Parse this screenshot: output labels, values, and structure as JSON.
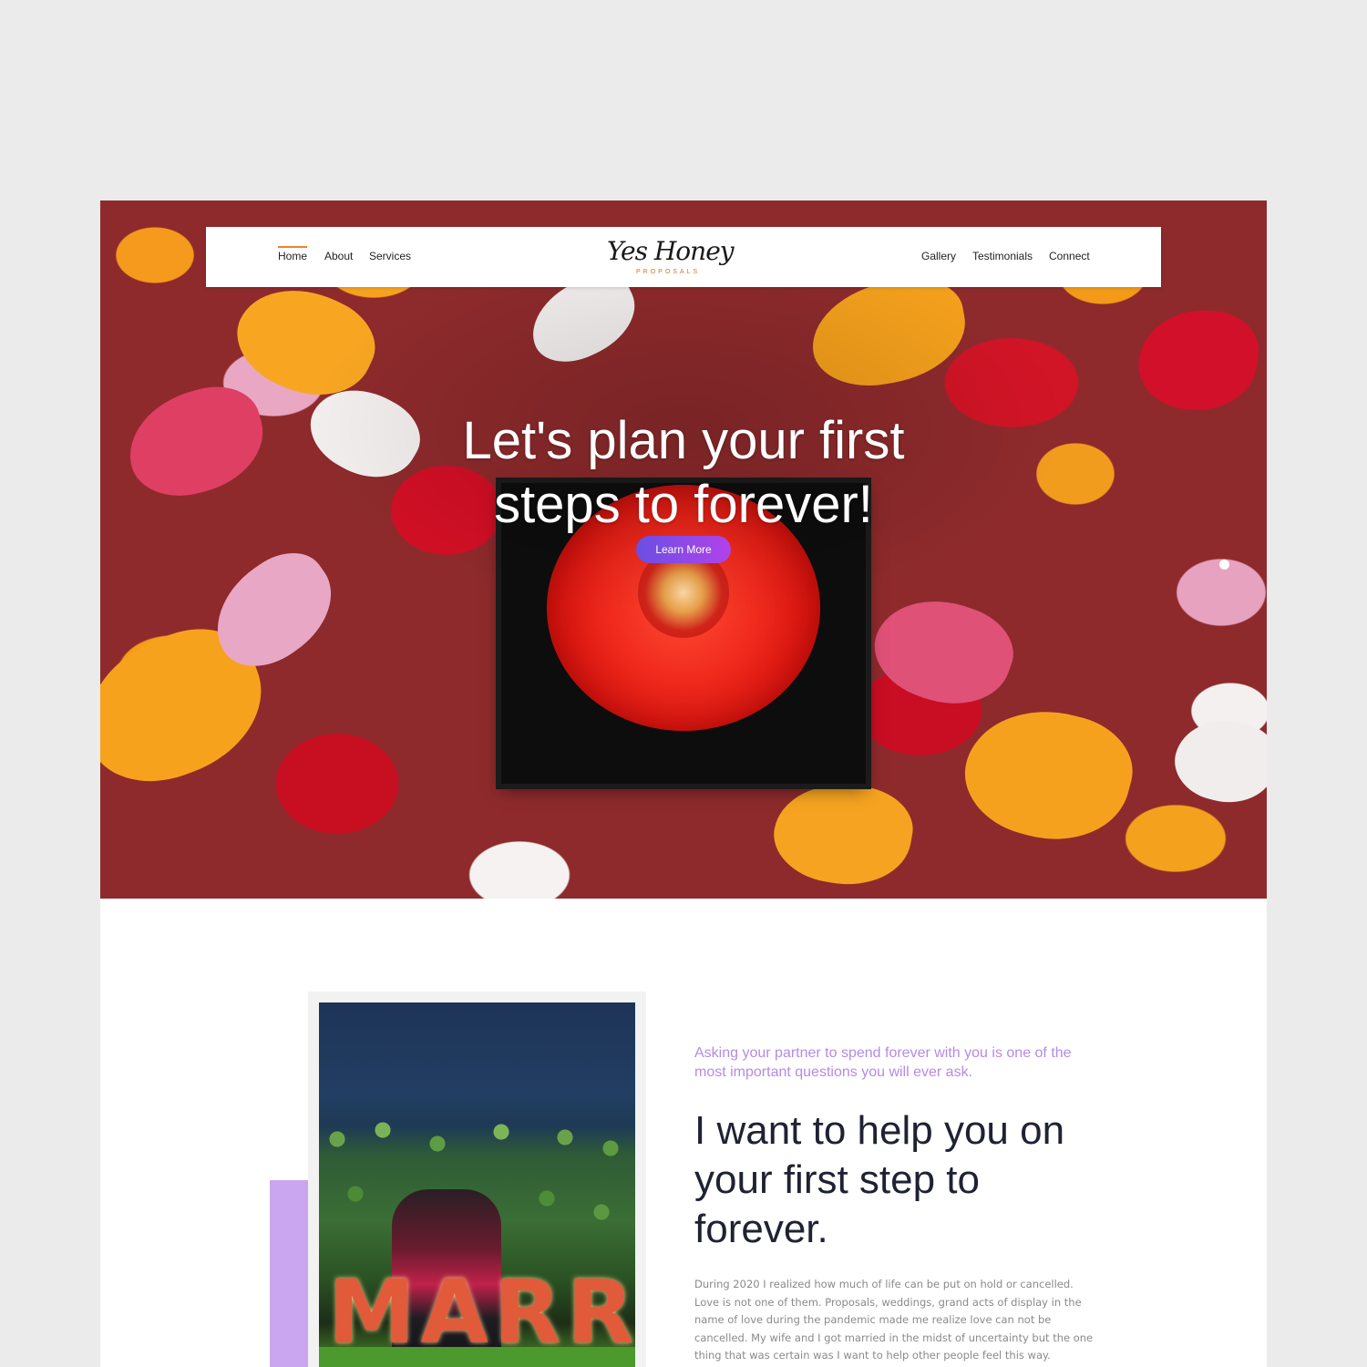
{
  "nav": {
    "left_items": [
      "Home",
      "About",
      "Services"
    ],
    "right_items": [
      "Gallery",
      "Testimonials",
      "Connect"
    ],
    "active": "Home",
    "accent_color": "#e8862a"
  },
  "logo": {
    "script": "Yes Honey",
    "subtitle": "PROPOSALS"
  },
  "hero": {
    "title_line1": "Let's plan your first",
    "title_line2": "steps to forever!",
    "button_label": "Learn More",
    "button_gradient": [
      "#6a4fe3",
      "#b043ea"
    ]
  },
  "about": {
    "intro": "Asking your partner to spend forever with you is one of the most important questions you will ever ask.",
    "heading": "I want to help you on your first step to forever.",
    "body": "During 2020 I realized how much of life can be put on hold or cancelled. Love is not one of them. Proposals, weddings, grand acts of display in the name of love during the pandemic made me realize love can not be cancelled. My wife and I got married in the midst of uncertainty but the one thing that was certain was I want to help other people feel this way.",
    "photo_sign_letters": "MARR",
    "accent_color": "#c9a6ef",
    "intro_color": "#b68ae6"
  }
}
